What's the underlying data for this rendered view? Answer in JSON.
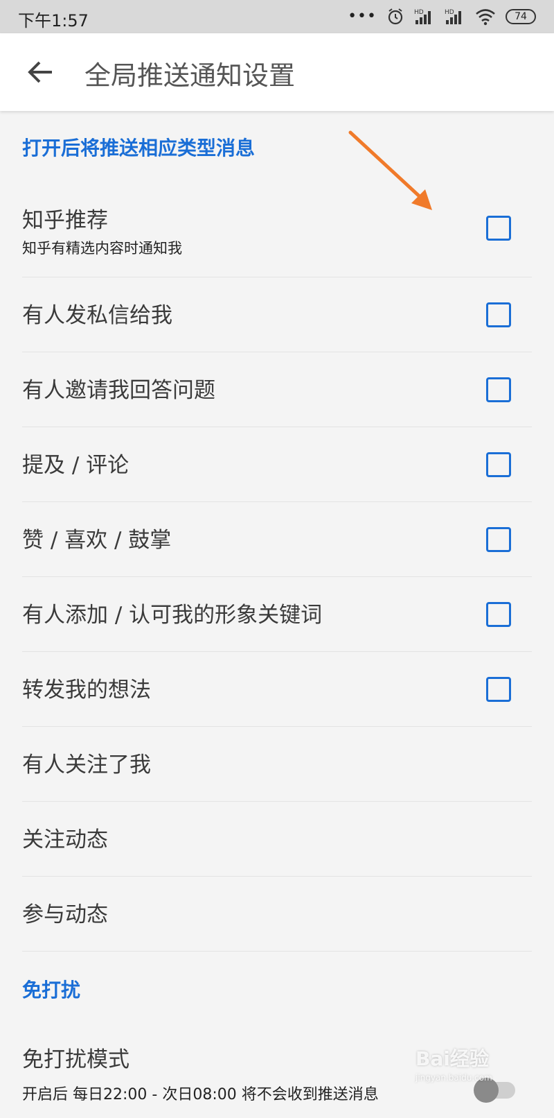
{
  "status_bar": {
    "time": "下午1:57",
    "dots": "•••",
    "battery": "74",
    "network_label": "HD"
  },
  "app_bar": {
    "title": "全局推送通知设置",
    "back_icon": "arrow-left-icon"
  },
  "sections": {
    "push_header": "打开后将推送相应类型消息",
    "dnd_header": "免打扰"
  },
  "push_items": [
    {
      "title": "知乎推荐",
      "subtitle": "知乎有精选内容时通知我"
    },
    {
      "title": "有人发私信给我"
    },
    {
      "title": "有人邀请我回答问题"
    },
    {
      "title": "提及 / 评论"
    },
    {
      "title": "赞 / 喜欢 / 鼓掌"
    },
    {
      "title": "有人添加 / 认可我的形象关键词"
    },
    {
      "title": "转发我的想法"
    }
  ],
  "plain_items": [
    {
      "title": "有人关注了我"
    },
    {
      "title": "关注动态"
    },
    {
      "title": "参与动态"
    }
  ],
  "dnd_item": {
    "title": "免打扰模式",
    "subtitle": "开启后 每日22:00 - 次日08:00 将不会收到推送消息"
  },
  "colors": {
    "accent": "#1a6ed6",
    "arrow": "#f07a2a",
    "background": "#f4f4f4"
  },
  "watermark": {
    "text": "Bai经验",
    "sub": "jingyan.baidu.com"
  }
}
